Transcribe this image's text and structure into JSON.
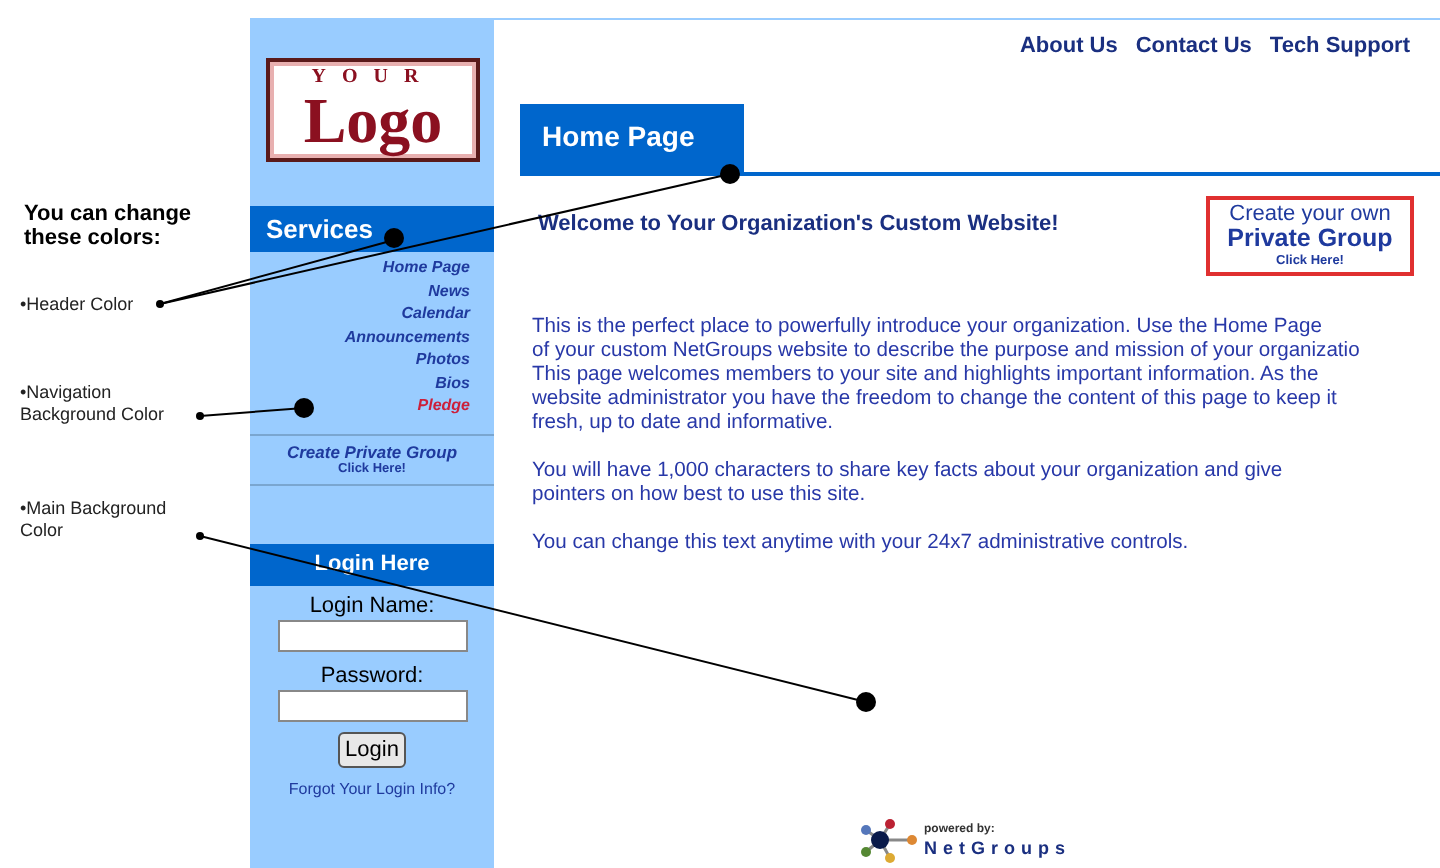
{
  "annotations": {
    "heading": "You can change these colors:",
    "items": [
      {
        "label": "•Header Color"
      },
      {
        "label": "•Navigation Background Color"
      },
      {
        "label": "•Main Background Color"
      }
    ]
  },
  "logo": {
    "top": "YOUR",
    "main": "Logo"
  },
  "top_links": [
    "About Us",
    "Contact Us",
    "Tech Support"
  ],
  "sidebar": {
    "header": "Services",
    "items": [
      {
        "label": "Home Page",
        "color": "#1f3a9e"
      },
      {
        "label": "News",
        "color": "#1f3a9e"
      },
      {
        "label": "Calendar",
        "color": "#1f3a9e"
      },
      {
        "label": "Announcements",
        "color": "#1f3a9e"
      },
      {
        "label": "Photos",
        "color": "#1f3a9e"
      },
      {
        "label": "Bios",
        "color": "#1f3a9e"
      },
      {
        "label": "Pledge",
        "color": "#cc1f3a"
      }
    ],
    "promo": {
      "title": "Create Private Group",
      "subtitle": "Click Here!"
    },
    "login": {
      "header": "Login Here",
      "name_label": "Login Name:",
      "password_label": "Password:",
      "button": "Login",
      "forgot": "Forgot Your Login Info?"
    }
  },
  "tab": {
    "label": "Home Page"
  },
  "welcome": "Welcome to Your Organization's Custom Website!",
  "promo_box": {
    "line1": "Create your own",
    "line2": "Private Group",
    "line3": "Click Here!"
  },
  "paragraphs": [
    [
      "This is the perfect place to powerfully introduce your organization. Use the Home Page",
      "of your custom NetGroups website to describe the purpose and mission of your organizatio",
      "This page welcomes members to your site and highlights important information. As the",
      "website administrator you have the freedom to change the content of this page to keep it",
      "fresh, up to date and informative."
    ],
    [
      "You will have 1,000 characters to share key facts about your organization and give",
      "pointers on how best to use this site."
    ],
    [
      "You can change this text anytime with your 24x7 administrative controls."
    ]
  ],
  "footer": {
    "powered": "powered by:",
    "brand": "NetGroups"
  }
}
